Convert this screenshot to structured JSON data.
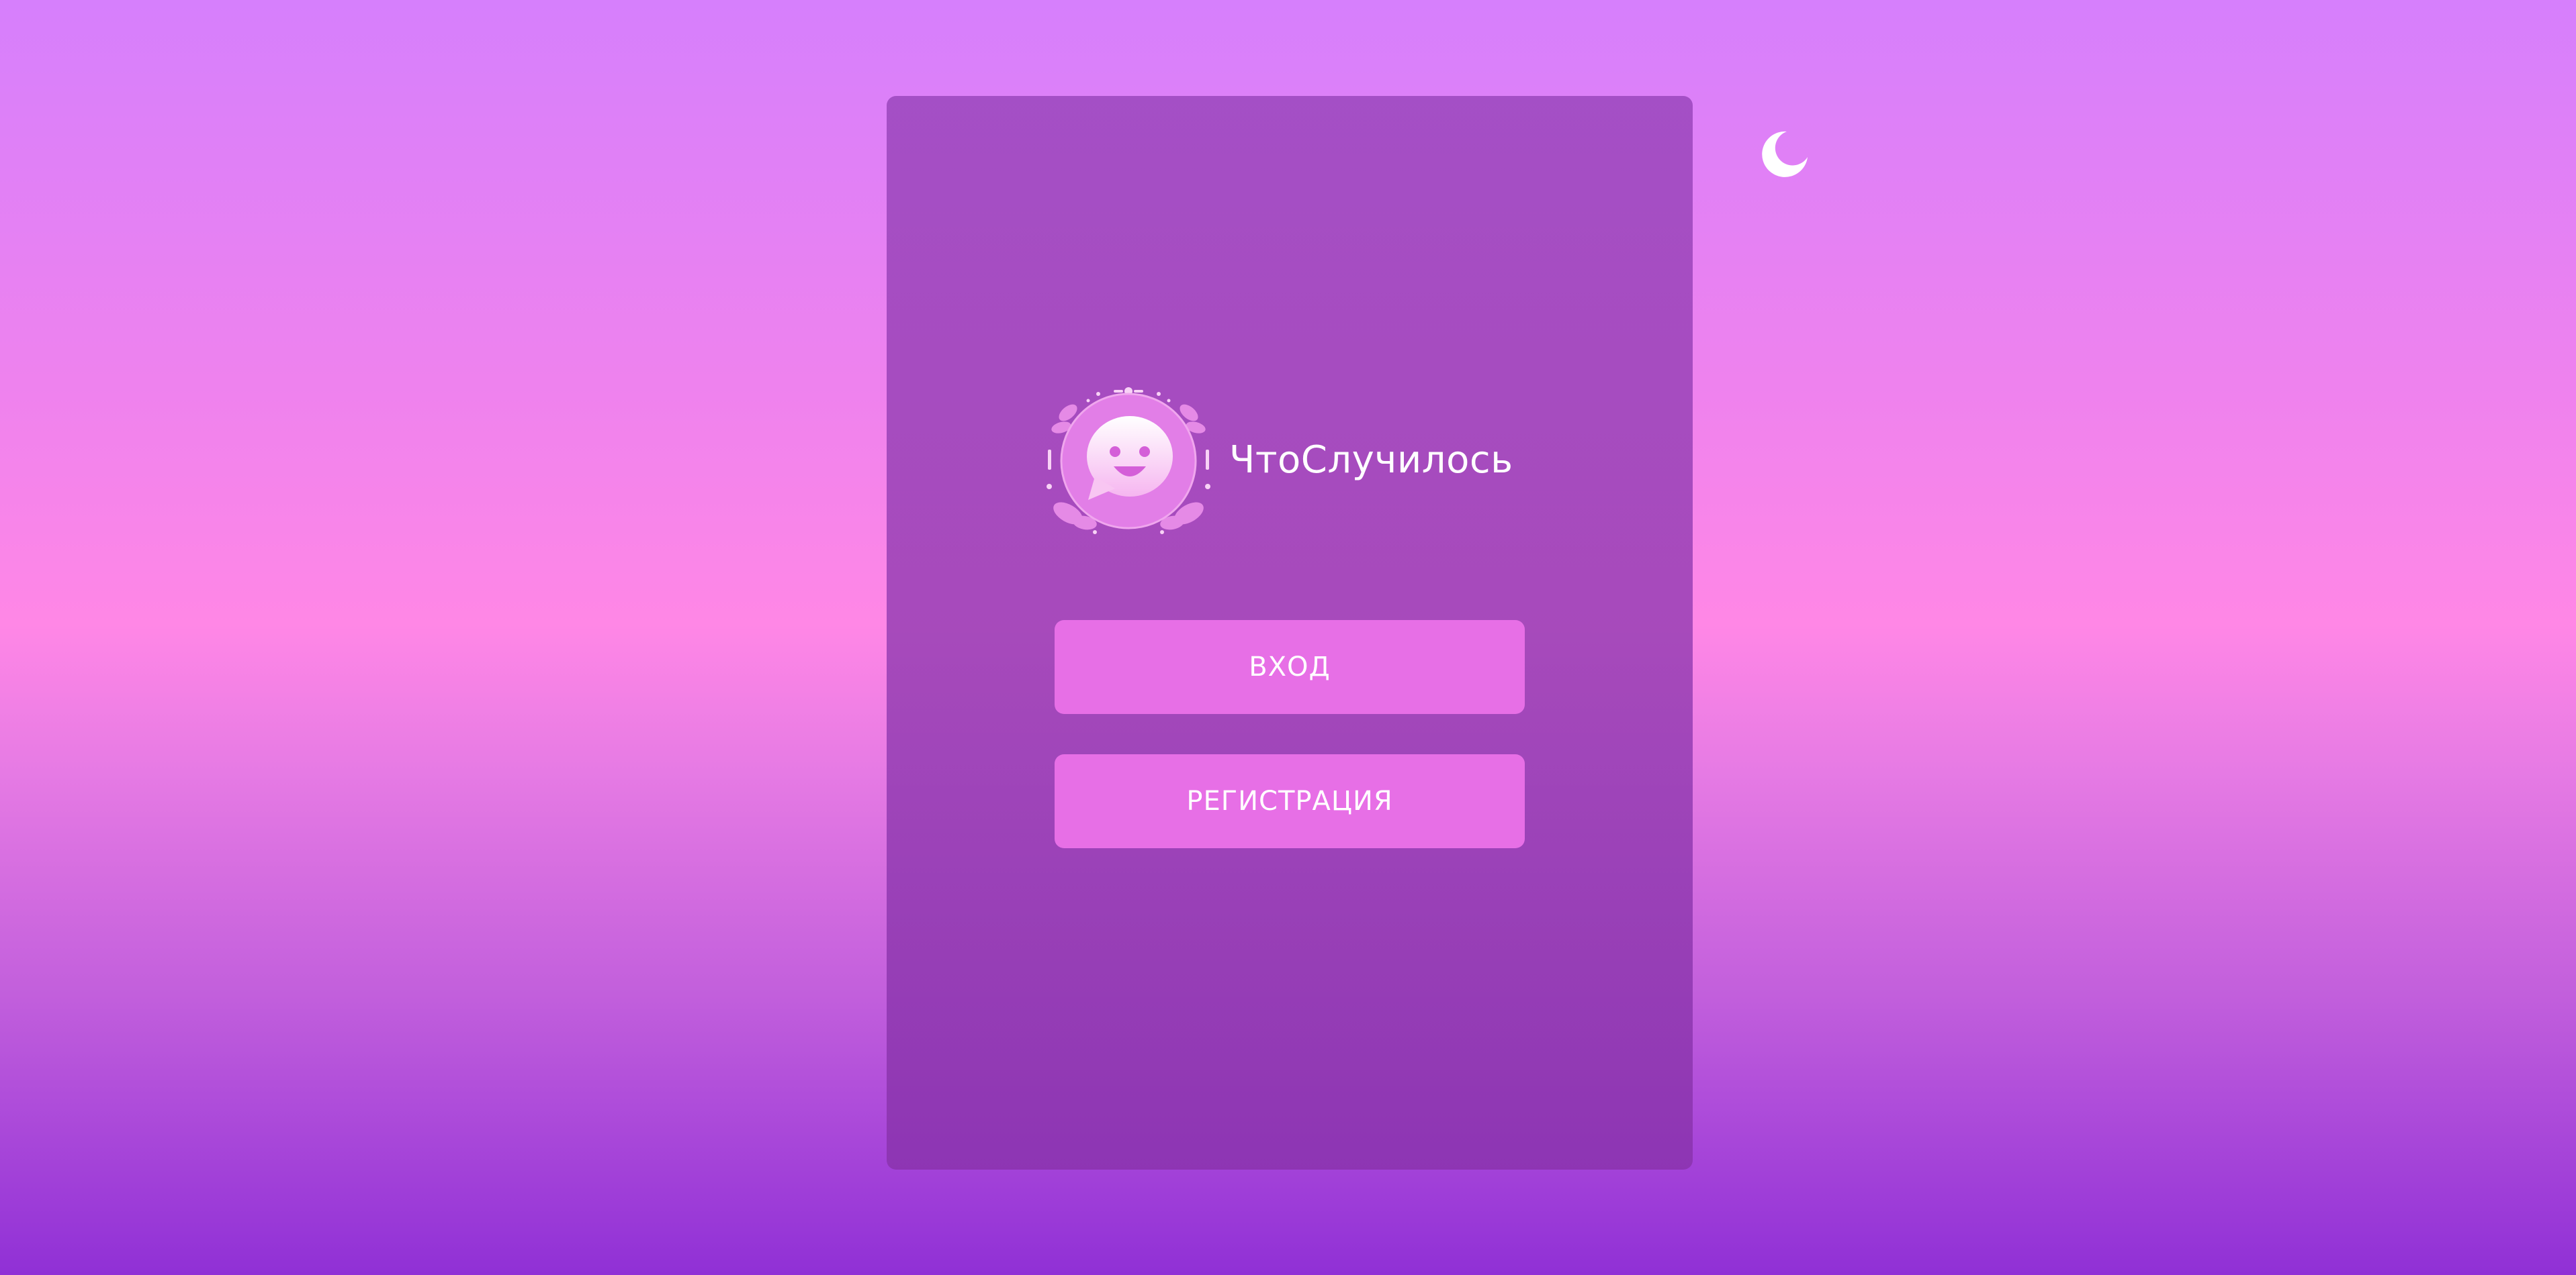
{
  "app": {
    "name": "ЧтоСлучилось"
  },
  "auth": {
    "login_label": "ВХОД",
    "register_label": "РЕГИСТРАЦИЯ"
  },
  "header": {
    "theme_toggle_icon": "moon-icon",
    "logo_icon": "smiling-chat-bubble-logo"
  },
  "colors": {
    "background_top": "#d67ffc",
    "background_mid": "#ff87e6",
    "background_bottom": "#9030d6",
    "card": "#9c45b8",
    "button": "#e76fe6",
    "text": "#ffffff"
  }
}
